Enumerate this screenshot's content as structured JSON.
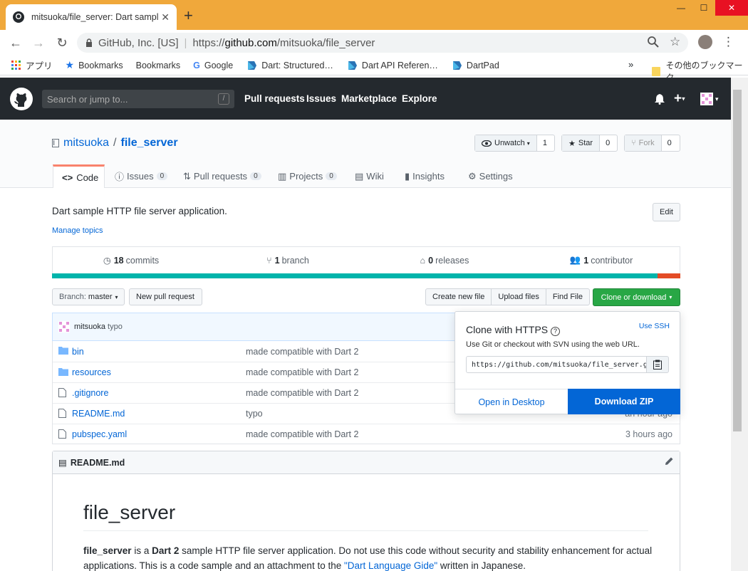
{
  "browser": {
    "tab_title": "mitsuoka/file_server: Dart sample",
    "org": "GitHub, Inc. [US]",
    "url_prefix": "https://",
    "url_host": "github.com",
    "url_path": "/mitsuoka/file_server",
    "bookmarks": [
      {
        "label": "アプリ",
        "icon": "apps-grid-icon"
      },
      {
        "label": "Bookmarks",
        "icon": "star-icon"
      },
      {
        "label": "Bookmarks",
        "icon": "none"
      },
      {
        "label": "Google",
        "icon": "google-icon"
      },
      {
        "label": "Dart: Structured…",
        "icon": "dart-icon"
      },
      {
        "label": "Dart API Referen…",
        "icon": "dart-icon"
      },
      {
        "label": "DartPad",
        "icon": "dart-icon"
      }
    ],
    "bookmarks_overflow": "»",
    "other_bookmarks": "その他のブックマーク"
  },
  "header": {
    "search_placeholder": "Search or jump to...",
    "slash": "/",
    "nav": [
      "Pull requests",
      "Issues",
      "Marketplace",
      "Explore"
    ]
  },
  "repo": {
    "owner": "mitsuoka",
    "separator": "/",
    "name": "file_server",
    "watch_label": "Unwatch",
    "watch_count": "1",
    "star_label": "Star",
    "star_count": "0",
    "fork_label": "Fork",
    "fork_count": "0",
    "tabs": [
      {
        "label": "Code",
        "count": ""
      },
      {
        "label": "Issues",
        "count": "0"
      },
      {
        "label": "Pull requests",
        "count": "0"
      },
      {
        "label": "Projects",
        "count": "0"
      },
      {
        "label": "Wiki",
        "count": ""
      },
      {
        "label": "Insights",
        "count": ""
      },
      {
        "label": "Settings",
        "count": ""
      }
    ],
    "description": "Dart sample HTTP file server application.",
    "manage_topics": "Manage topics",
    "edit": "Edit",
    "commits_num": "18",
    "commits_label": "commits",
    "branch_num": "1",
    "branch_label": "branch",
    "releases_num": "0",
    "releases_label": "releases",
    "contributor_num": "1",
    "contributor_label": "contributor",
    "lang_colors": [
      "#00b4ab",
      "#e34c26"
    ],
    "lang_fractions": [
      0.964,
      0.036
    ],
    "branch_button_label": "Branch:",
    "branch_button_value": "master",
    "new_pr": "New pull request",
    "create_file": "Create new file",
    "upload_files": "Upload files",
    "find_file": "Find File",
    "clone_download": "Clone or download",
    "commit_author": "mitsuoka",
    "commit_message": "typo",
    "files": [
      {
        "name": "bin",
        "type": "folder",
        "message": "made compatible with Dart 2",
        "age": ""
      },
      {
        "name": "resources",
        "type": "folder",
        "message": "made compatible with Dart 2",
        "age": ""
      },
      {
        "name": ".gitignore",
        "type": "file",
        "message": "made compatible with Dart 2",
        "age": ""
      },
      {
        "name": "README.md",
        "type": "file",
        "message": "typo",
        "age": "an hour ago"
      },
      {
        "name": "pubspec.yaml",
        "type": "file",
        "message": "made compatible with Dart 2",
        "age": "3 hours ago"
      }
    ]
  },
  "clone": {
    "title": "Clone with HTTPS",
    "use_ssh": "Use SSH",
    "subtitle": "Use Git or checkout with SVN using the web URL.",
    "url": "https://github.com/mitsuoka/file_server.git",
    "open_desktop": "Open in Desktop",
    "download_zip": "Download ZIP"
  },
  "readme": {
    "header": "README.md",
    "h1": "file_server",
    "p1_b1": "file_server",
    "p1_t1": " is a ",
    "p1_b2": "Dart 2",
    "p1_t2": " sample HTTP file server application. Do not use this code without security and stability enhancement for actual applications. This is a code sample and an attachment to the ",
    "p1_link": "\"Dart Language Gide\"",
    "p1_t3": " written in Japanese."
  }
}
